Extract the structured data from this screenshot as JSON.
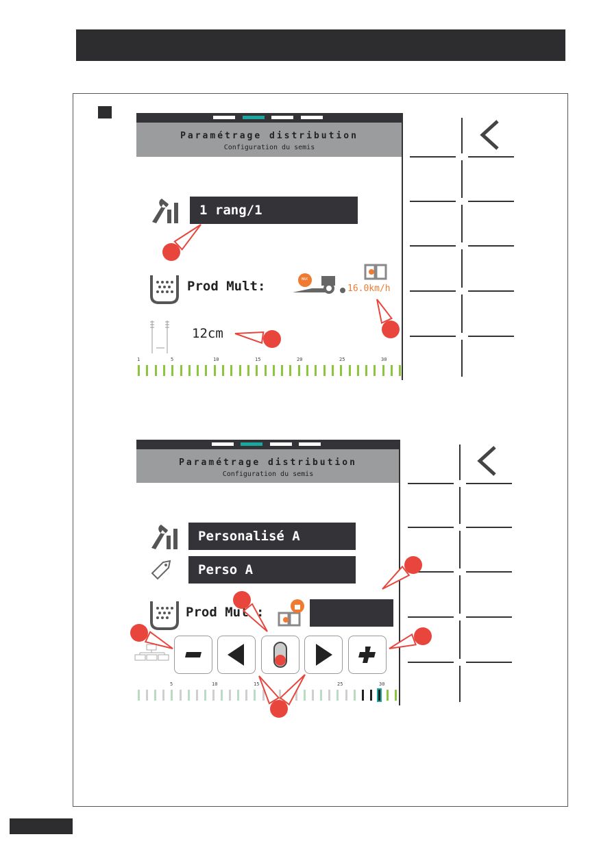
{
  "screen1": {
    "title": "Paramétrage distribution",
    "subtitle": "Configuration du semis",
    "mode_value": "1 rang/1",
    "product_label": "Prod Mult:",
    "speed_value": "16.0km/h",
    "spacing_value": "12cm",
    "max_badge": "MAX",
    "scale_labels": [
      "1",
      "5",
      "10",
      "15",
      "20",
      "25",
      "30"
    ],
    "active_page_indicator": 2,
    "row_count": 32,
    "row_colors": "all-green"
  },
  "screen2": {
    "title": "Paramétrage distribution",
    "subtitle": "Configuration du semis",
    "mode_value": "Personalisé A",
    "name_value": "Perso A",
    "product_label": "Prod Mult:",
    "product_value": "",
    "scale_labels": [
      "5",
      "10",
      "15",
      "25",
      "30"
    ],
    "buttons": [
      "minus",
      "previous",
      "toggle",
      "next",
      "plus"
    ]
  },
  "colors": {
    "accent": "#18a8a0",
    "callout": "#e8453c",
    "speed": "#f07a30",
    "row_active": "#8cc63f",
    "row_light": "#b8dcc4",
    "row_gray": "#cfcfcf",
    "dark": "#333338"
  },
  "icons": [
    "wrench-rows-icon",
    "hopper-icon",
    "tractor-max-icon",
    "manual-book-icon",
    "row-spacing-icon",
    "tag-icon",
    "lock-icon",
    "tree-icon",
    "back-chevron-icon"
  ]
}
